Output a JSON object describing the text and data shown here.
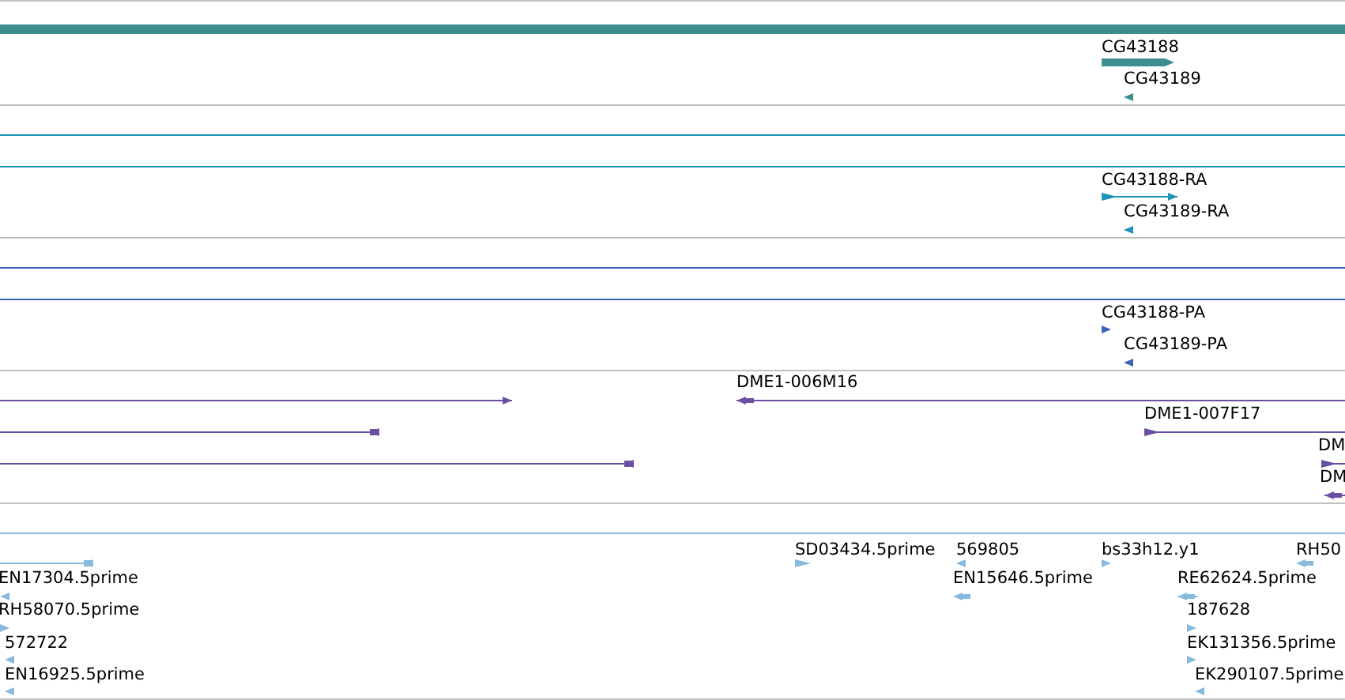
{
  "tracks": [
    {
      "color": "#3d8f8f",
      "features": [
        {
          "kind": "bar"
        },
        {
          "kind": "thick",
          "label": "CG43188",
          "reverse": false
        },
        {
          "kind": "arrow",
          "label": "CG43189",
          "reverse": true
        }
      ]
    },
    {
      "color": "#1e93b5",
      "features": [
        {
          "kind": "line"
        },
        {
          "kind": "line"
        },
        {
          "kind": "arrow",
          "label": "CG43188-RA",
          "reverse": false
        },
        {
          "kind": "arrow",
          "label": "CG43189-RA",
          "reverse": true
        }
      ]
    },
    {
      "color": "#3a62b8",
      "features": [
        {
          "kind": "line"
        },
        {
          "kind": "line"
        },
        {
          "kind": "arrow",
          "label": "CG43188-PA",
          "reverse": false
        },
        {
          "kind": "arrow",
          "label": "CG43189-PA",
          "reverse": true
        }
      ]
    },
    {
      "color": "#6b4fa3",
      "features": [
        {
          "kind": "arrow",
          "reverse": false
        },
        {
          "kind": "arrow",
          "label": "DME1-006M16",
          "reverse": true
        },
        {
          "kind": "arrow",
          "reverse": true
        },
        {
          "kind": "arrow",
          "label": "DME1-007F17",
          "reverse": false
        },
        {
          "kind": "arrow",
          "reverse": true
        },
        {
          "kind": "arrow",
          "label": "DM",
          "reverse": false
        },
        {
          "kind": "arrow",
          "label": "DM",
          "reverse": true
        }
      ]
    },
    {
      "color": "#86bbdd",
      "features": [
        {
          "kind": "arrow",
          "reverse": true
        },
        {
          "kind": "arrow",
          "label": "EN17304.5prime",
          "reverse": true
        },
        {
          "kind": "arrow",
          "label": "RH58070.5prime",
          "reverse": false
        },
        {
          "kind": "arrow",
          "label": "572722",
          "reverse": true
        },
        {
          "kind": "arrow",
          "label": "EN16925.5prime",
          "reverse": true
        },
        {
          "kind": "arrow",
          "label": "SD03434.5prime",
          "reverse": false
        },
        {
          "kind": "arrow",
          "label": "569805",
          "reverse": true
        },
        {
          "kind": "arrow",
          "label": "EN15646.5prime",
          "reverse": true
        },
        {
          "kind": "arrow",
          "label": "bs33h12.y1",
          "reverse": false
        },
        {
          "kind": "arrow",
          "label": "RH50",
          "reverse": true
        },
        {
          "kind": "arrow",
          "label": "RE62624.5prime",
          "reverse": true
        },
        {
          "kind": "arrow",
          "label": "187628",
          "reverse": false
        },
        {
          "kind": "arrow",
          "label": "EK131356.5prime",
          "reverse": false
        },
        {
          "kind": "arrow",
          "label": "EK290107.5prime",
          "reverse": true
        }
      ]
    }
  ]
}
